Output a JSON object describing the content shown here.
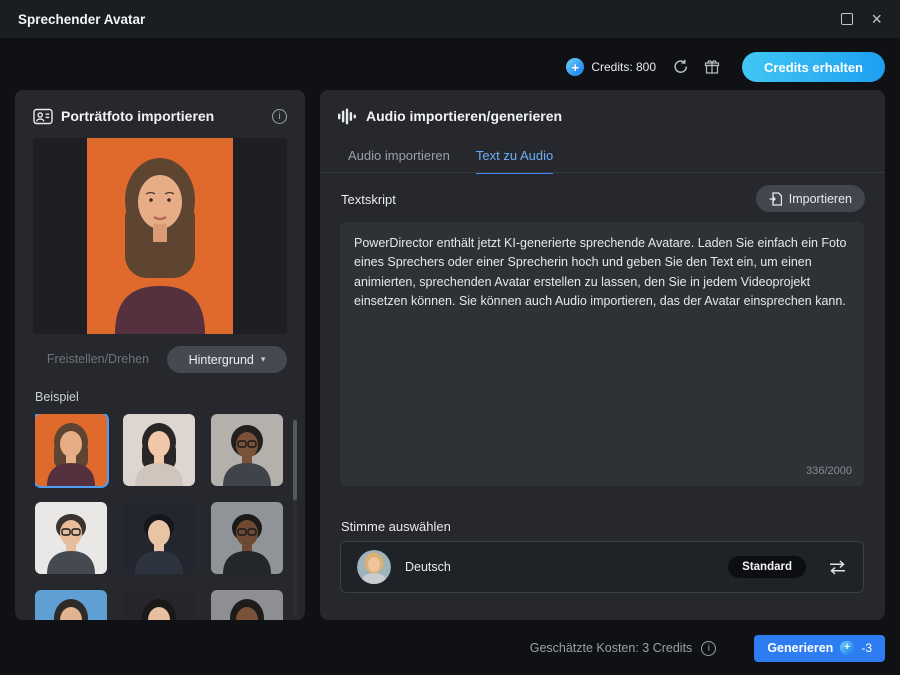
{
  "window": {
    "title": "Sprechender Avatar"
  },
  "header": {
    "credits_label": "Credits: 800",
    "get_credits_button": "Credits erhalten"
  },
  "left_panel": {
    "title": "Porträtfoto importieren",
    "crop_button": "Freistellen/Drehen",
    "background_button": "Hintergrund",
    "examples_label": "Beispiel",
    "examples": [
      {
        "bg": "#e06a2b",
        "hair": "#5d4531",
        "skin": "#e7ad87",
        "top": "#55303f",
        "selected": true
      },
      {
        "bg": "#ddd6d0",
        "hair": "#2a2526",
        "skin": "#f0c7a8",
        "top": "#cfc5bd",
        "selected": false
      },
      {
        "bg": "#b4b0ac",
        "hair": "#221f1e",
        "skin": "#7a5239",
        "top": "#3f444b",
        "selected": false
      },
      {
        "bg": "#eae8e6",
        "hair": "#3a332e",
        "skin": "#e8bd9c",
        "top": "#454a51",
        "selected": false
      },
      {
        "bg": "#23262e",
        "hair": "#17161a",
        "skin": "#e9c4a4",
        "top": "#2e3340",
        "selected": false
      },
      {
        "bg": "#909398",
        "hair": "#1c1a19",
        "skin": "#6e4a33",
        "top": "#23262b",
        "selected": false
      },
      {
        "bg": "#5f9fd4",
        "hair": "#2e2a28",
        "skin": "#e0b491",
        "top": "#37404a",
        "selected": false
      },
      {
        "bg": "#26262a",
        "hair": "#1a1818",
        "skin": "#e6c0a0",
        "top": "#303540",
        "selected": false
      },
      {
        "bg": "#8e8f93",
        "hair": "#1e1c1b",
        "skin": "#7a5239",
        "top": "#26292e",
        "selected": false
      }
    ]
  },
  "right_panel": {
    "title": "Audio importieren/generieren",
    "tabs": [
      {
        "label": "Audio importieren",
        "active": false
      },
      {
        "label": "Text zu Audio",
        "active": true
      }
    ],
    "textscript_label": "Textskript",
    "import_button": "Importieren",
    "script_text": "PowerDirector enthält jetzt KI-generierte sprechende Avatare. Laden Sie einfach ein Foto eines Sprechers oder einer Sprecherin hoch und geben Sie den Text ein, um einen animierten, sprechenden Avatar erstellen zu lassen, den Sie in jedem Videoprojekt einsetzen können. Sie können auch Audio importieren, das der Avatar einsprechen kann.",
    "char_count": "336/2000",
    "voice_label": "Stimme auswählen",
    "voice": {
      "name": "Deutsch",
      "badge": "Standard"
    }
  },
  "footer": {
    "cost_label": "Geschätzte Kosten: 3 Credits",
    "generate_button": "Generieren",
    "credit_delta": "-3"
  },
  "icons": {
    "close": "×",
    "caret_down": "▾",
    "plus": "+",
    "info": "i"
  },
  "colors": {
    "accent_blue": "#2e7cf2",
    "cyan_button_start": "#41c7f5",
    "cyan_button_end": "#1d9ff0",
    "tab_active": "#3d8bf8",
    "selected_thumb_border": "#4f9cf5"
  }
}
